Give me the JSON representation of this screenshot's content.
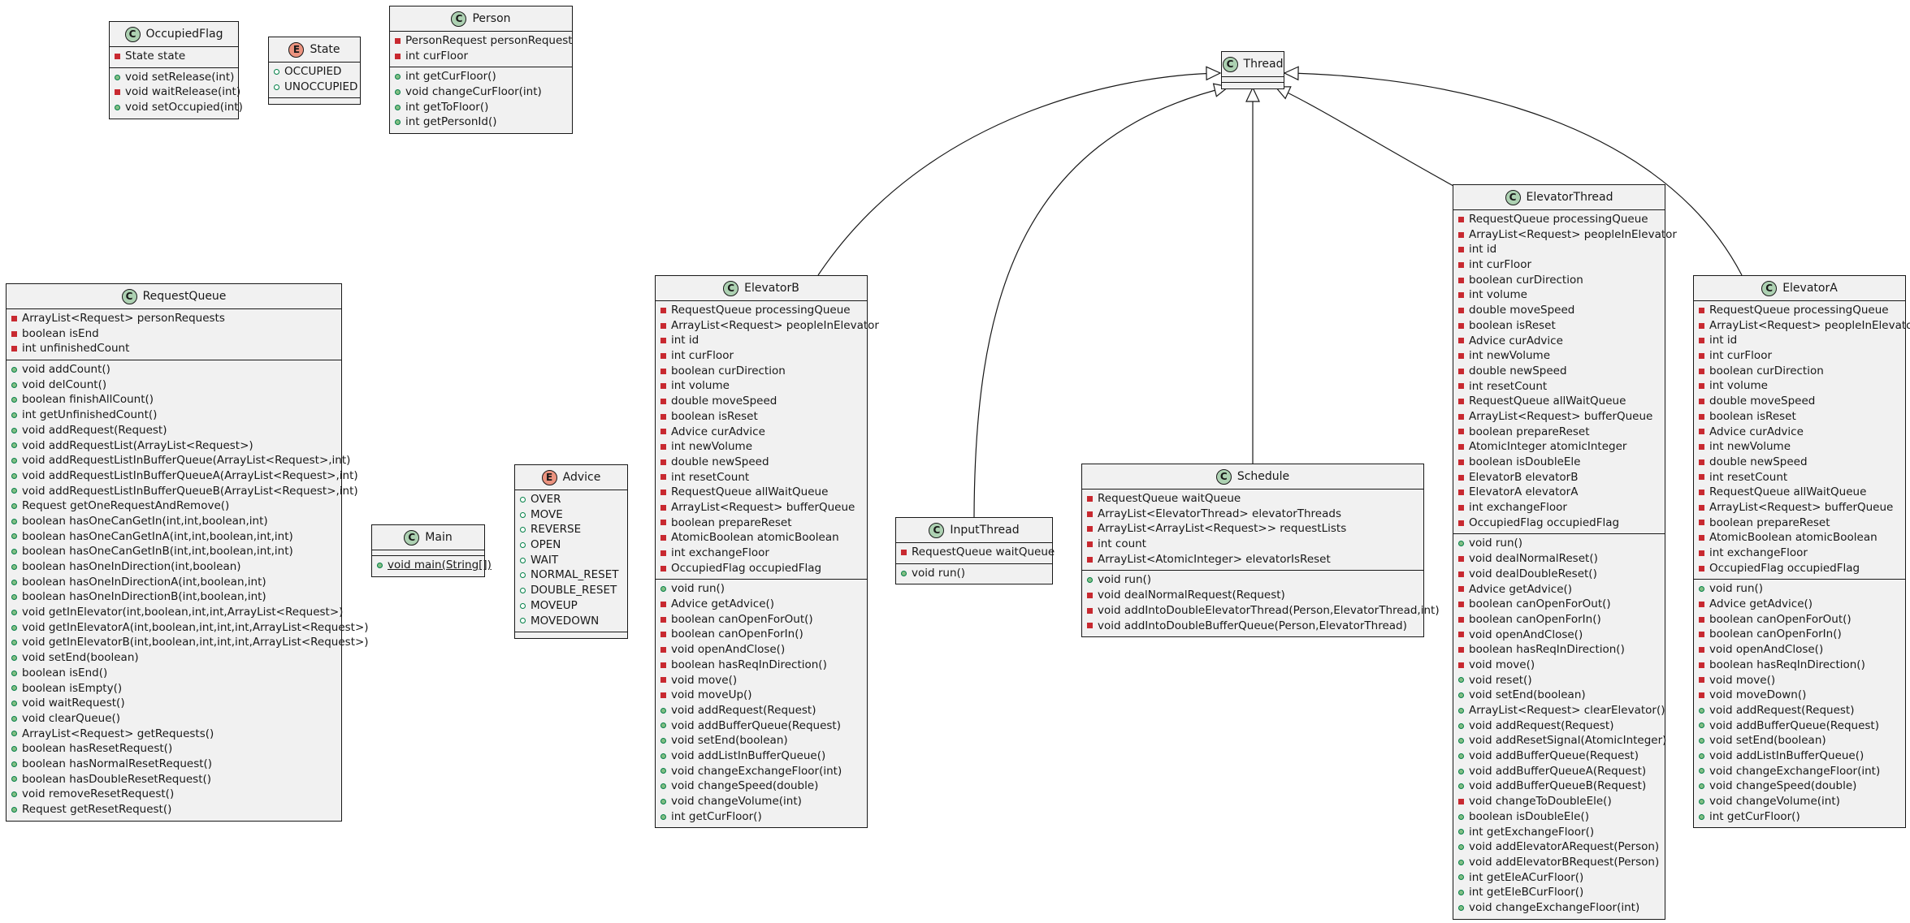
{
  "classes": [
    {
      "id": "OccupiedFlag",
      "kind": "C",
      "name": "OccupiedFlag",
      "fields": [
        {
          "v": "priv",
          "t": "State state"
        }
      ],
      "methods": [
        {
          "v": "pub",
          "t": "void setRelease(int)"
        },
        {
          "v": "priv",
          "t": "void waitRelease(int)"
        },
        {
          "v": "pub",
          "t": "void setOccupied(int)"
        }
      ]
    },
    {
      "id": "State",
      "kind": "E",
      "name": "State",
      "fields": [
        {
          "v": "lit",
          "t": "OCCUPIED"
        },
        {
          "v": "lit",
          "t": "UNOCCUPIED"
        }
      ],
      "methods": []
    },
    {
      "id": "Person",
      "kind": "C",
      "name": "Person",
      "fields": [
        {
          "v": "priv",
          "t": "PersonRequest personRequest"
        },
        {
          "v": "priv",
          "t": "int curFloor"
        }
      ],
      "methods": [
        {
          "v": "pub",
          "t": "int getCurFloor()"
        },
        {
          "v": "pub",
          "t": "void changeCurFloor(int)"
        },
        {
          "v": "pub",
          "t": "int getToFloor()"
        },
        {
          "v": "pub",
          "t": "int getPersonId()"
        }
      ]
    },
    {
      "id": "Thread",
      "kind": "C",
      "name": "Thread",
      "fields": [],
      "methods": []
    },
    {
      "id": "RequestQueue",
      "kind": "C",
      "name": "RequestQueue",
      "fields": [
        {
          "v": "priv",
          "t": "ArrayList<Request> personRequests"
        },
        {
          "v": "priv",
          "t": "boolean isEnd"
        },
        {
          "v": "priv",
          "t": "int unfinishedCount"
        }
      ],
      "methods": [
        {
          "v": "pub",
          "t": "void addCount()"
        },
        {
          "v": "pub",
          "t": "void delCount()"
        },
        {
          "v": "pub",
          "t": "boolean finishAllCount()"
        },
        {
          "v": "pub",
          "t": "int getUnfinishedCount()"
        },
        {
          "v": "pub",
          "t": "void addRequest(Request)"
        },
        {
          "v": "pub",
          "t": "void addRequestList(ArrayList<Request>)"
        },
        {
          "v": "pub",
          "t": "void addRequestListInBufferQueue(ArrayList<Request>,int)"
        },
        {
          "v": "pub",
          "t": "void addRequestListInBufferQueueA(ArrayList<Request>,int)"
        },
        {
          "v": "pub",
          "t": "void addRequestListInBufferQueueB(ArrayList<Request>,int)"
        },
        {
          "v": "pub",
          "t": "Request getOneRequestAndRemove()"
        },
        {
          "v": "pub",
          "t": "boolean hasOneCanGetIn(int,int,boolean,int)"
        },
        {
          "v": "pub",
          "t": "boolean hasOneCanGetInA(int,int,boolean,int,int)"
        },
        {
          "v": "pub",
          "t": "boolean hasOneCanGetInB(int,int,boolean,int,int)"
        },
        {
          "v": "pub",
          "t": "boolean hasOneInDirection(int,boolean)"
        },
        {
          "v": "pub",
          "t": "boolean hasOneInDirectionA(int,boolean,int)"
        },
        {
          "v": "pub",
          "t": "boolean hasOneInDirectionB(int,boolean,int)"
        },
        {
          "v": "pub",
          "t": "void getInElevator(int,boolean,int,int,ArrayList<Request>)"
        },
        {
          "v": "pub",
          "t": "void getInElevatorA(int,boolean,int,int,int,ArrayList<Request>)"
        },
        {
          "v": "pub",
          "t": "void getInElevatorB(int,boolean,int,int,int,ArrayList<Request>)"
        },
        {
          "v": "pub",
          "t": "void setEnd(boolean)"
        },
        {
          "v": "pub",
          "t": "boolean isEnd()"
        },
        {
          "v": "pub",
          "t": "boolean isEmpty()"
        },
        {
          "v": "pub",
          "t": "void waitRequest()"
        },
        {
          "v": "pub",
          "t": "void clearQueue()"
        },
        {
          "v": "pub",
          "t": "ArrayList<Request> getRequests()"
        },
        {
          "v": "pub",
          "t": "boolean hasResetRequest()"
        },
        {
          "v": "pub",
          "t": "boolean hasNormalResetRequest()"
        },
        {
          "v": "pub",
          "t": "boolean hasDoubleResetRequest()"
        },
        {
          "v": "pub",
          "t": "void removeResetRequest()"
        },
        {
          "v": "pub",
          "t": "Request getResetRequest()"
        }
      ]
    },
    {
      "id": "Main",
      "kind": "C",
      "name": "Main",
      "fields": [],
      "methods": [
        {
          "v": "pub",
          "t": "void main(String[])",
          "static": true
        }
      ]
    },
    {
      "id": "Advice",
      "kind": "E",
      "name": "Advice",
      "fields": [
        {
          "v": "lit",
          "t": "OVER"
        },
        {
          "v": "lit",
          "t": "MOVE"
        },
        {
          "v": "lit",
          "t": "REVERSE"
        },
        {
          "v": "lit",
          "t": "OPEN"
        },
        {
          "v": "lit",
          "t": "WAIT"
        },
        {
          "v": "lit",
          "t": "NORMAL_RESET"
        },
        {
          "v": "lit",
          "t": "DOUBLE_RESET"
        },
        {
          "v": "lit",
          "t": "MOVEUP"
        },
        {
          "v": "lit",
          "t": "MOVEDOWN"
        }
      ],
      "methods": []
    },
    {
      "id": "ElevatorB",
      "kind": "C",
      "name": "ElevatorB",
      "fields": [
        {
          "v": "priv",
          "t": "RequestQueue processingQueue"
        },
        {
          "v": "priv",
          "t": "ArrayList<Request> peopleInElevator"
        },
        {
          "v": "priv",
          "t": "int id"
        },
        {
          "v": "priv",
          "t": "int curFloor"
        },
        {
          "v": "priv",
          "t": "boolean curDirection"
        },
        {
          "v": "priv",
          "t": "int volume"
        },
        {
          "v": "priv",
          "t": "double moveSpeed"
        },
        {
          "v": "priv",
          "t": "boolean isReset"
        },
        {
          "v": "priv",
          "t": "Advice curAdvice"
        },
        {
          "v": "priv",
          "t": "int newVolume"
        },
        {
          "v": "priv",
          "t": "double newSpeed"
        },
        {
          "v": "priv",
          "t": "int resetCount"
        },
        {
          "v": "priv",
          "t": "RequestQueue allWaitQueue"
        },
        {
          "v": "priv",
          "t": "ArrayList<Request> bufferQueue"
        },
        {
          "v": "priv",
          "t": "boolean prepareReset"
        },
        {
          "v": "priv",
          "t": "AtomicBoolean atomicBoolean"
        },
        {
          "v": "priv",
          "t": "int exchangeFloor"
        },
        {
          "v": "priv",
          "t": "OccupiedFlag occupiedFlag"
        }
      ],
      "methods": [
        {
          "v": "pub",
          "t": "void run()"
        },
        {
          "v": "priv",
          "t": "Advice getAdvice()"
        },
        {
          "v": "priv",
          "t": "boolean canOpenForOut()"
        },
        {
          "v": "priv",
          "t": "boolean canOpenForIn()"
        },
        {
          "v": "priv",
          "t": "void openAndClose()"
        },
        {
          "v": "priv",
          "t": "boolean hasReqInDirection()"
        },
        {
          "v": "priv",
          "t": "void move()"
        },
        {
          "v": "priv",
          "t": "void moveUp()"
        },
        {
          "v": "pub",
          "t": "void addRequest(Request)"
        },
        {
          "v": "pub",
          "t": "void addBufferQueue(Request)"
        },
        {
          "v": "pub",
          "t": "void setEnd(boolean)"
        },
        {
          "v": "pub",
          "t": "void addListInBufferQueue()"
        },
        {
          "v": "pub",
          "t": "void changeExchangeFloor(int)"
        },
        {
          "v": "pub",
          "t": "void changeSpeed(double)"
        },
        {
          "v": "pub",
          "t": "void changeVolume(int)"
        },
        {
          "v": "pub",
          "t": "int getCurFloor()"
        }
      ]
    },
    {
      "id": "InputThread",
      "kind": "C",
      "name": "InputThread",
      "fields": [
        {
          "v": "priv",
          "t": "RequestQueue waitQueue"
        }
      ],
      "methods": [
        {
          "v": "pub",
          "t": "void run()"
        }
      ]
    },
    {
      "id": "Schedule",
      "kind": "C",
      "name": "Schedule",
      "fields": [
        {
          "v": "priv",
          "t": "RequestQueue waitQueue"
        },
        {
          "v": "priv",
          "t": "ArrayList<ElevatorThread> elevatorThreads"
        },
        {
          "v": "priv",
          "t": "ArrayList<ArrayList<Request>> requestLists"
        },
        {
          "v": "priv",
          "t": "int count"
        },
        {
          "v": "priv",
          "t": "ArrayList<AtomicInteger> elevatorIsReset"
        }
      ],
      "methods": [
        {
          "v": "pub",
          "t": "void run()"
        },
        {
          "v": "priv",
          "t": "void dealNormalRequest(Request)"
        },
        {
          "v": "priv",
          "t": "void addIntoDoubleElevatorThread(Person,ElevatorThread,int)"
        },
        {
          "v": "priv",
          "t": "void addIntoDoubleBufferQueue(Person,ElevatorThread)"
        }
      ]
    },
    {
      "id": "ElevatorThread",
      "kind": "C",
      "name": "ElevatorThread",
      "fields": [
        {
          "v": "priv",
          "t": "RequestQueue processingQueue"
        },
        {
          "v": "priv",
          "t": "ArrayList<Request> peopleInElevator"
        },
        {
          "v": "priv",
          "t": "int id"
        },
        {
          "v": "priv",
          "t": "int curFloor"
        },
        {
          "v": "priv",
          "t": "boolean curDirection"
        },
        {
          "v": "priv",
          "t": "int volume"
        },
        {
          "v": "priv",
          "t": "double moveSpeed"
        },
        {
          "v": "priv",
          "t": "boolean isReset"
        },
        {
          "v": "priv",
          "t": "Advice curAdvice"
        },
        {
          "v": "priv",
          "t": "int newVolume"
        },
        {
          "v": "priv",
          "t": "double newSpeed"
        },
        {
          "v": "priv",
          "t": "int resetCount"
        },
        {
          "v": "priv",
          "t": "RequestQueue allWaitQueue"
        },
        {
          "v": "priv",
          "t": "ArrayList<Request> bufferQueue"
        },
        {
          "v": "priv",
          "t": "boolean prepareReset"
        },
        {
          "v": "priv",
          "t": "AtomicInteger atomicInteger"
        },
        {
          "v": "priv",
          "t": "boolean isDoubleEle"
        },
        {
          "v": "priv",
          "t": "ElevatorB elevatorB"
        },
        {
          "v": "priv",
          "t": "ElevatorA elevatorA"
        },
        {
          "v": "priv",
          "t": "int exchangeFloor"
        },
        {
          "v": "priv",
          "t": "OccupiedFlag occupiedFlag"
        }
      ],
      "methods": [
        {
          "v": "pub",
          "t": "void run()"
        },
        {
          "v": "priv",
          "t": "void dealNormalReset()"
        },
        {
          "v": "priv",
          "t": "void dealDoubleReset()"
        },
        {
          "v": "priv",
          "t": "Advice getAdvice()"
        },
        {
          "v": "priv",
          "t": "boolean canOpenForOut()"
        },
        {
          "v": "priv",
          "t": "boolean canOpenForIn()"
        },
        {
          "v": "priv",
          "t": "void openAndClose()"
        },
        {
          "v": "priv",
          "t": "boolean hasReqInDirection()"
        },
        {
          "v": "priv",
          "t": "void move()"
        },
        {
          "v": "pub",
          "t": "void reset()"
        },
        {
          "v": "pub",
          "t": "void setEnd(boolean)"
        },
        {
          "v": "pub",
          "t": "ArrayList<Request> clearElevator()"
        },
        {
          "v": "pub",
          "t": "void addRequest(Request)"
        },
        {
          "v": "pub",
          "t": "void addResetSignal(AtomicInteger)"
        },
        {
          "v": "pub",
          "t": "void addBufferQueue(Request)"
        },
        {
          "v": "pub",
          "t": "void addBufferQueueA(Request)"
        },
        {
          "v": "pub",
          "t": "void addBufferQueueB(Request)"
        },
        {
          "v": "priv",
          "t": "void changeToDoubleEle()"
        },
        {
          "v": "pub",
          "t": "boolean isDoubleEle()"
        },
        {
          "v": "pub",
          "t": "int getExchangeFloor()"
        },
        {
          "v": "pub",
          "t": "void addElevatorARequest(Person)"
        },
        {
          "v": "pub",
          "t": "void addElevatorBRequest(Person)"
        },
        {
          "v": "pub",
          "t": "int getEleACurFloor()"
        },
        {
          "v": "pub",
          "t": "int getEleBCurFloor()"
        },
        {
          "v": "pub",
          "t": "void changeExchangeFloor(int)"
        }
      ]
    },
    {
      "id": "ElevatorA",
      "kind": "C",
      "name": "ElevatorA",
      "fields": [
        {
          "v": "priv",
          "t": "RequestQueue processingQueue"
        },
        {
          "v": "priv",
          "t": "ArrayList<Request> peopleInElevator"
        },
        {
          "v": "priv",
          "t": "int id"
        },
        {
          "v": "priv",
          "t": "int curFloor"
        },
        {
          "v": "priv",
          "t": "boolean curDirection"
        },
        {
          "v": "priv",
          "t": "int volume"
        },
        {
          "v": "priv",
          "t": "double moveSpeed"
        },
        {
          "v": "priv",
          "t": "boolean isReset"
        },
        {
          "v": "priv",
          "t": "Advice curAdvice"
        },
        {
          "v": "priv",
          "t": "int newVolume"
        },
        {
          "v": "priv",
          "t": "double newSpeed"
        },
        {
          "v": "priv",
          "t": "int resetCount"
        },
        {
          "v": "priv",
          "t": "RequestQueue allWaitQueue"
        },
        {
          "v": "priv",
          "t": "ArrayList<Request> bufferQueue"
        },
        {
          "v": "priv",
          "t": "boolean prepareReset"
        },
        {
          "v": "priv",
          "t": "AtomicBoolean atomicBoolean"
        },
        {
          "v": "priv",
          "t": "int exchangeFloor"
        },
        {
          "v": "priv",
          "t": "OccupiedFlag occupiedFlag"
        }
      ],
      "methods": [
        {
          "v": "pub",
          "t": "void run()"
        },
        {
          "v": "priv",
          "t": "Advice getAdvice()"
        },
        {
          "v": "priv",
          "t": "boolean canOpenForOut()"
        },
        {
          "v": "priv",
          "t": "boolean canOpenForIn()"
        },
        {
          "v": "priv",
          "t": "void openAndClose()"
        },
        {
          "v": "priv",
          "t": "boolean hasReqInDirection()"
        },
        {
          "v": "priv",
          "t": "void move()"
        },
        {
          "v": "priv",
          "t": "void moveDown()"
        },
        {
          "v": "pub",
          "t": "void addRequest(Request)"
        },
        {
          "v": "pub",
          "t": "void addBufferQueue(Request)"
        },
        {
          "v": "pub",
          "t": "void setEnd(boolean)"
        },
        {
          "v": "pub",
          "t": "void addListInBufferQueue()"
        },
        {
          "v": "pub",
          "t": "void changeExchangeFloor(int)"
        },
        {
          "v": "pub",
          "t": "void changeSpeed(double)"
        },
        {
          "v": "pub",
          "t": "void changeVolume(int)"
        },
        {
          "v": "pub",
          "t": "int getCurFloor()"
        }
      ]
    }
  ],
  "inheritance": [
    {
      "from": "ElevatorB",
      "to": "Thread"
    },
    {
      "from": "InputThread",
      "to": "Thread"
    },
    {
      "from": "Schedule",
      "to": "Thread"
    },
    {
      "from": "ElevatorThread",
      "to": "Thread"
    },
    {
      "from": "ElevatorA",
      "to": "Thread"
    }
  ]
}
